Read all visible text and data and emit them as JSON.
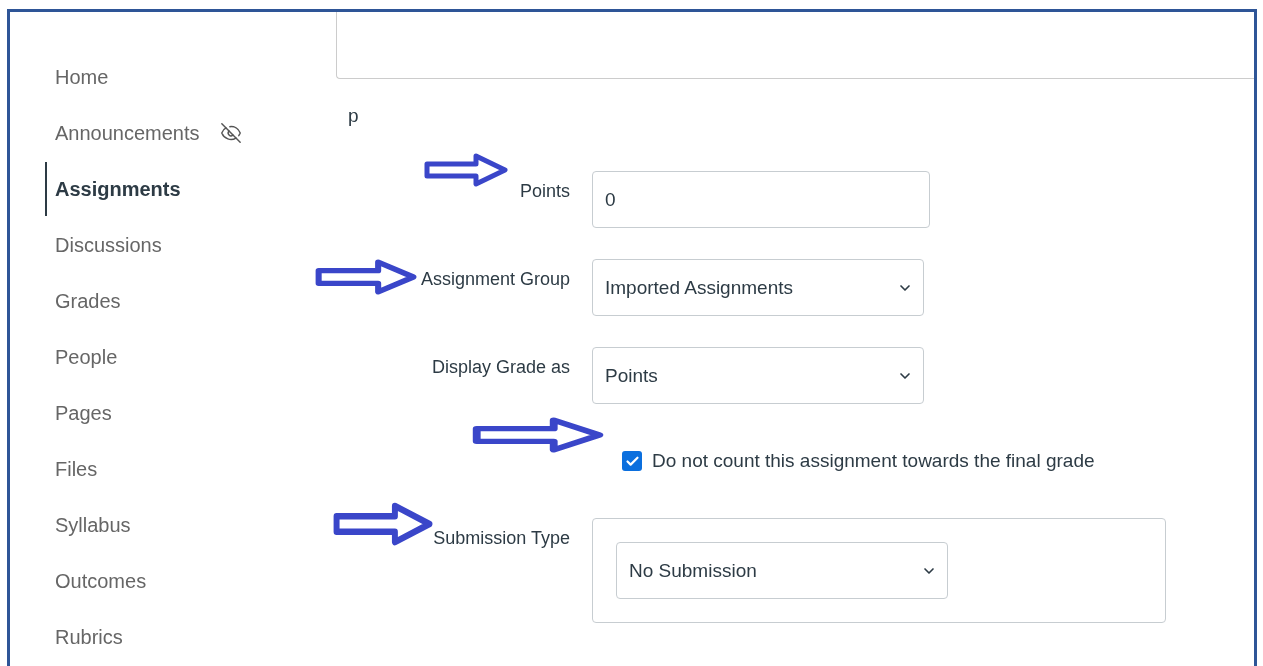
{
  "sidebar": {
    "items": [
      {
        "label": "Home",
        "selected": false,
        "hidden": false
      },
      {
        "label": "Announcements",
        "selected": false,
        "hidden": true
      },
      {
        "label": "Assignments",
        "selected": true,
        "hidden": false
      },
      {
        "label": "Discussions",
        "selected": false,
        "hidden": false
      },
      {
        "label": "Grades",
        "selected": false,
        "hidden": false
      },
      {
        "label": "People",
        "selected": false,
        "hidden": false
      },
      {
        "label": "Pages",
        "selected": false,
        "hidden": false
      },
      {
        "label": "Files",
        "selected": false,
        "hidden": false
      },
      {
        "label": "Syllabus",
        "selected": false,
        "hidden": false
      },
      {
        "label": "Outcomes",
        "selected": false,
        "hidden": false
      },
      {
        "label": "Rubrics",
        "selected": false,
        "hidden": false
      }
    ]
  },
  "content": {
    "text": "p"
  },
  "form": {
    "rows": [
      {
        "kind": "input",
        "label": "Points",
        "value": "0",
        "arrow": true
      },
      {
        "kind": "select",
        "label": "Assignment Group",
        "value": "Imported Assignments",
        "arrow": true
      },
      {
        "kind": "select",
        "label": "Display Grade as",
        "value": "Points",
        "arrow": false
      },
      {
        "kind": "checkbox",
        "label": "Do not count this assignment towards the final grade",
        "checked": true,
        "arrow": true
      },
      {
        "kind": "boxed_select",
        "label": "Submission Type",
        "value": "No Submission",
        "arrow": true
      }
    ]
  }
}
